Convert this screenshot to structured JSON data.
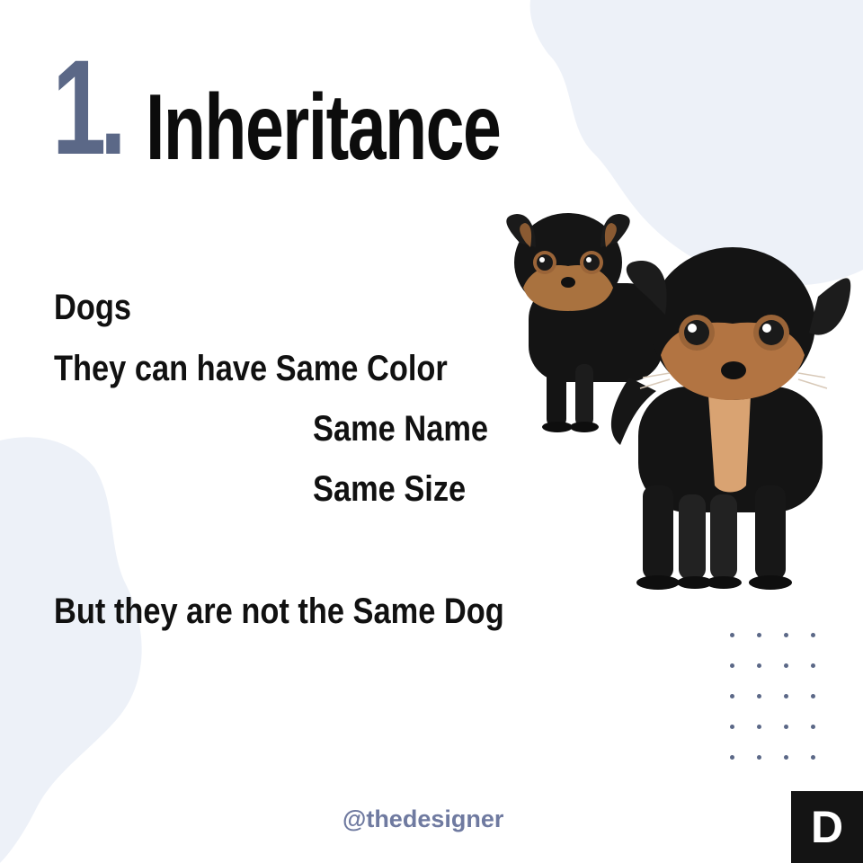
{
  "title": {
    "number": "1.",
    "word": "Inheritance"
  },
  "content": {
    "line1": "Dogs",
    "line2": "They can have Same Color",
    "line3": "Same Name",
    "line4": "Same Size",
    "line5": "But they are not the Same Dog"
  },
  "footer": {
    "handle": "@thedesigner",
    "logo_letter": "D"
  },
  "colors": {
    "accent": "#5b6887",
    "text": "#111111",
    "blob": "#edf1f8",
    "handle": "#6f7aa0",
    "logo_bg": "#141414"
  },
  "images": {
    "dogs": "two-cartoon-rottweiler-puppies"
  }
}
